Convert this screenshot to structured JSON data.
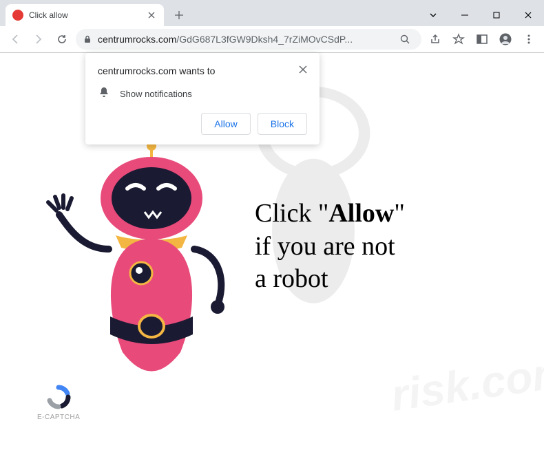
{
  "tab": {
    "title": "Click allow"
  },
  "address": {
    "domain": "centrumrocks.com",
    "path": "/GdG687L3fGW9Dksh4_7rZiMOvCSdP..."
  },
  "permission": {
    "title": "centrumrocks.com wants to",
    "message": "Show notifications",
    "allow_label": "Allow",
    "block_label": "Block"
  },
  "page": {
    "line1_pre": "Click \"",
    "line1_bold": "Allow",
    "line1_post": "\"",
    "line2": "if you are not",
    "line3": "a robot",
    "captcha_label": "E-CAPTCHA"
  },
  "watermark": "risk.com"
}
